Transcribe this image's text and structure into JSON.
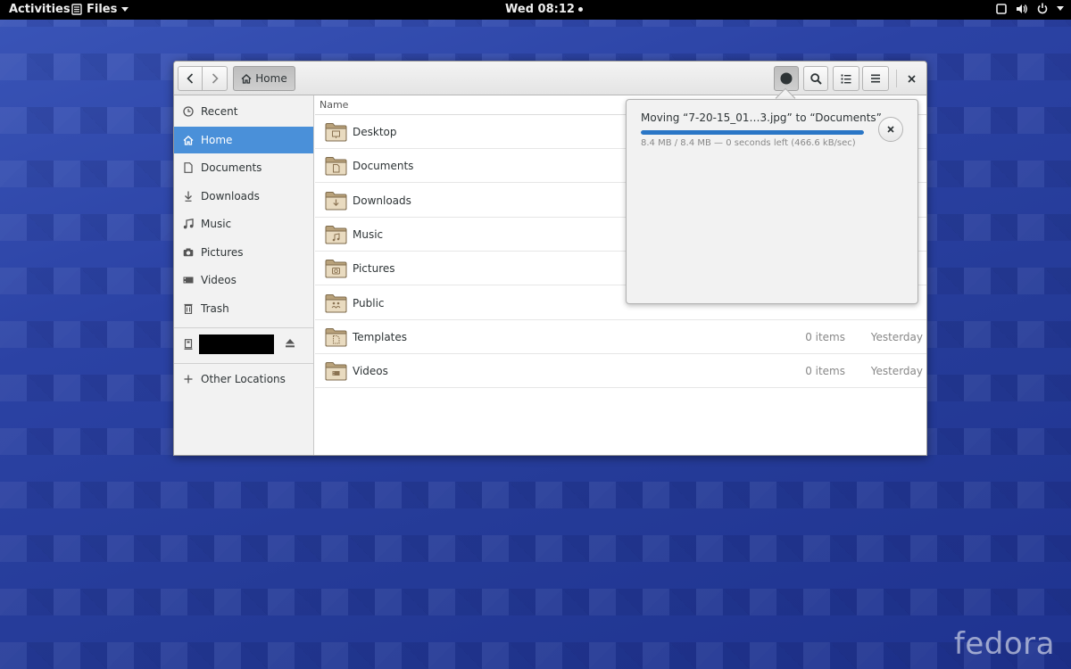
{
  "topbar": {
    "activities": "Activities",
    "app_menu": "Files",
    "clock": "Wed 08:12"
  },
  "window": {
    "pathbar": {
      "home_label": "Home"
    },
    "column_name": "Name",
    "sidebar": {
      "items": [
        {
          "label": "Recent",
          "icon": "clock-icon"
        },
        {
          "label": "Home",
          "icon": "home-icon",
          "active": true
        },
        {
          "label": "Documents",
          "icon": "document-icon"
        },
        {
          "label": "Downloads",
          "icon": "download-icon"
        },
        {
          "label": "Music",
          "icon": "music-icon"
        },
        {
          "label": "Pictures",
          "icon": "camera-icon"
        },
        {
          "label": "Videos",
          "icon": "video-icon"
        },
        {
          "label": "Trash",
          "icon": "trash-icon"
        }
      ],
      "other_locations": "Other Locations"
    },
    "files": [
      {
        "name": "Desktop",
        "size": "",
        "date": ""
      },
      {
        "name": "Documents",
        "size": "",
        "date": ""
      },
      {
        "name": "Downloads",
        "size": "",
        "date": ""
      },
      {
        "name": "Music",
        "size": "",
        "date": ""
      },
      {
        "name": "Pictures",
        "size": "",
        "date": ""
      },
      {
        "name": "Public",
        "size": "",
        "date": ""
      },
      {
        "name": "Templates",
        "size": "0 items",
        "date": "Yesterday"
      },
      {
        "name": "Videos",
        "size": "0 items",
        "date": "Yesterday"
      }
    ]
  },
  "operation": {
    "title": "Moving “7-20-15_01…3.jpg” to “Documents”",
    "status": "8.4 MB / 8.4 MB — 0 seconds left (466.6 kB/sec)",
    "progress": 1.0
  },
  "desktop": {
    "logo": "fedora"
  }
}
